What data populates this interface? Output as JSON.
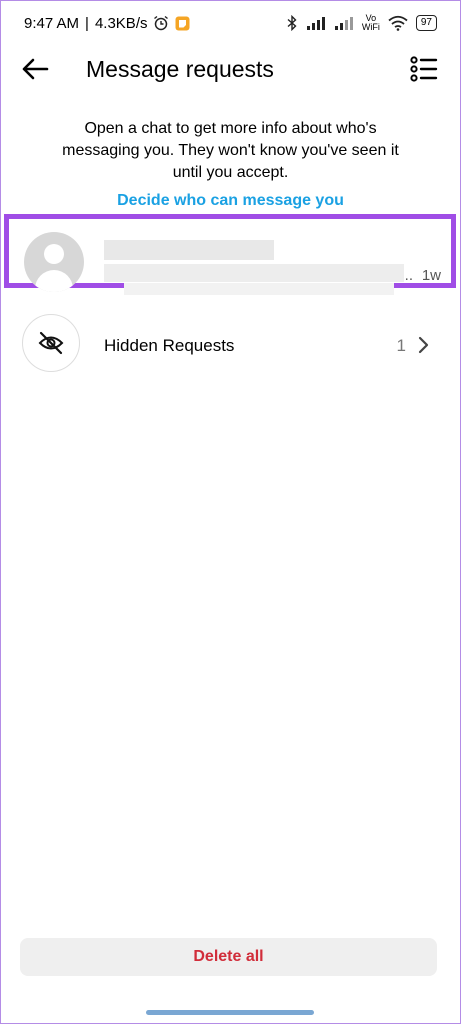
{
  "status_bar": {
    "time": "9:47 AM",
    "speed": "4.3KB/s",
    "vowifi_top": "Vo",
    "vowifi_bottom": "WiFi",
    "battery": "97"
  },
  "header": {
    "title": "Message requests"
  },
  "intro": {
    "text": "Open a chat to get more info about who's messaging you. They won't know you've seen it until you accept.",
    "link_label": "Decide who can message you"
  },
  "request": {
    "time": "1w",
    "ellipsis": ".."
  },
  "hidden_requests": {
    "label": "Hidden Requests",
    "count": "1"
  },
  "footer": {
    "delete_label": "Delete all"
  },
  "colors": {
    "accent": "#1aa1e3",
    "highlight": "#a04de6",
    "danger": "#d12d3a"
  }
}
